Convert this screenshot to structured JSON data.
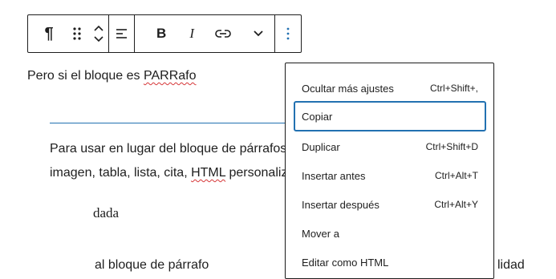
{
  "toolbar": {
    "paragraph_glyph": "¶",
    "bold_label": "B",
    "italic_label": "I",
    "icons": [
      "paragraph-icon",
      "drag-handle-icon",
      "chevron-up-icon",
      "chevron-down-icon",
      "align-left-icon",
      "link-icon",
      "chevron-down-icon",
      "more-vertical-icon"
    ]
  },
  "content": {
    "para1_prefix": "Pero si el bloque es ",
    "para1_squiggle": "PARRafo",
    "para2_line1": "Para usar en lugar del bloque de párrafos. Ide",
    "para2_line2_prefix": "imagen, tabla, lista, cita, ",
    "para2_line2_squiggle": "HTML",
    "para2_line2_suffix": " personalizado",
    "dada": "dada",
    "cut_text": "al bloque de párrafo",
    "cut_text_right": "lidad"
  },
  "menu": {
    "items": [
      {
        "label": "Ocultar más ajustes",
        "shortcut": "Ctrl+Shift+,"
      },
      {
        "label": "Copiar",
        "shortcut": ""
      },
      {
        "label": "Duplicar",
        "shortcut": "Ctrl+Shift+D"
      },
      {
        "label": "Insertar antes",
        "shortcut": "Ctrl+Alt+T"
      },
      {
        "label": "Insertar después",
        "shortcut": "Ctrl+Alt+Y"
      },
      {
        "label": "Mover a",
        "shortcut": ""
      },
      {
        "label": "Editar como HTML",
        "shortcut": ""
      }
    ]
  },
  "colors": {
    "accent": "#2271b1",
    "text": "#1e1e1e",
    "spellcheck": "#d63638"
  }
}
